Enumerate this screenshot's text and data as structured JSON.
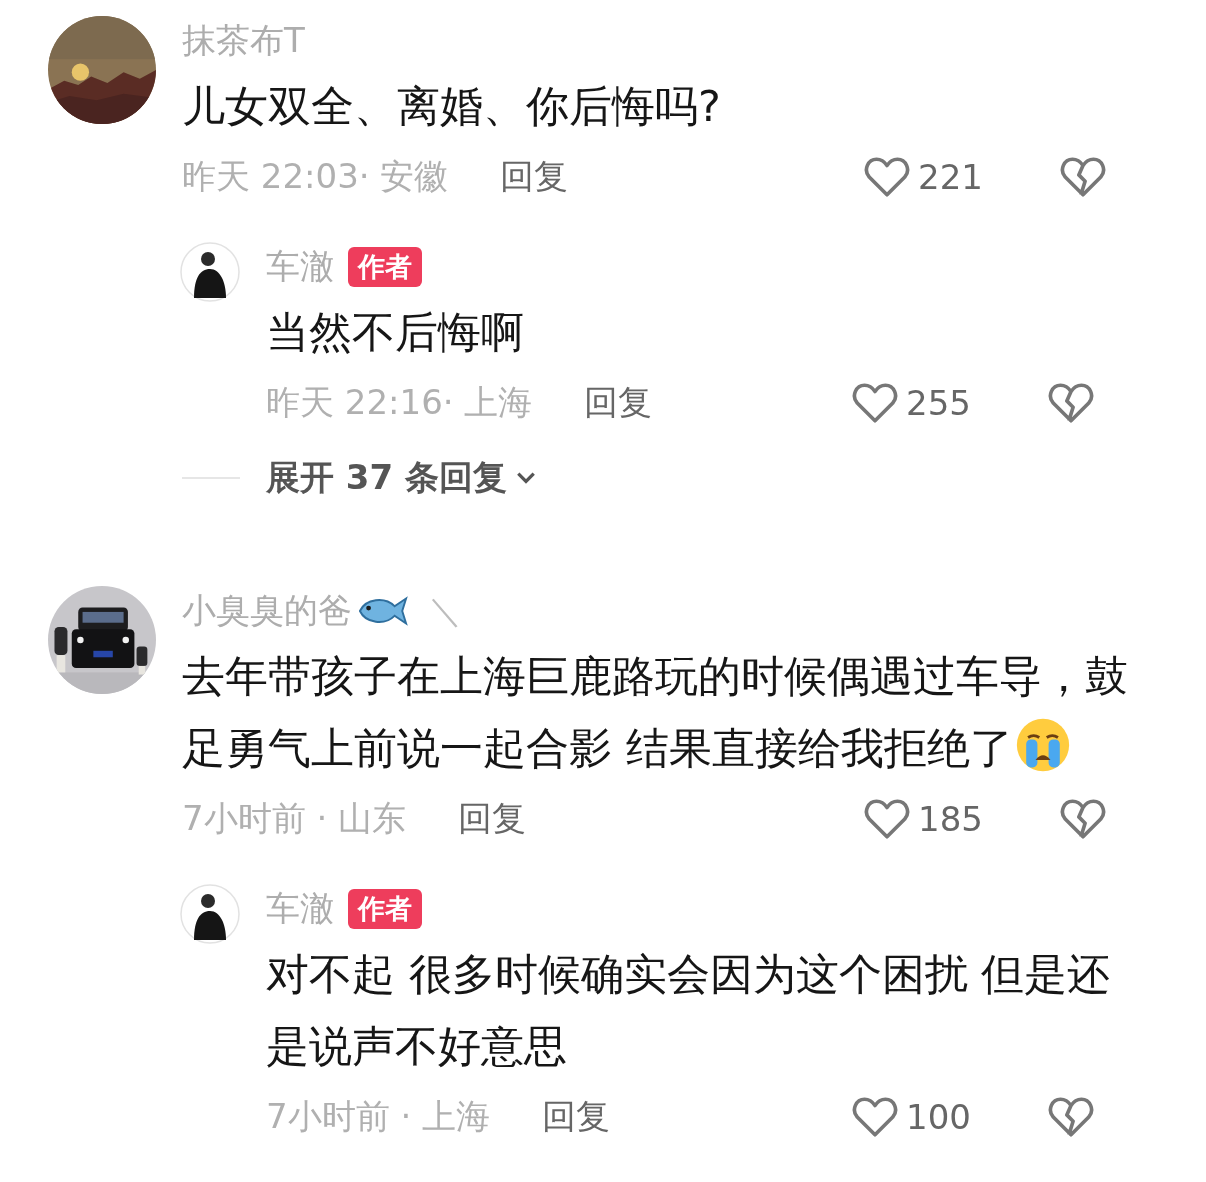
{
  "comments": [
    {
      "avatar": {
        "kind": "landscape"
      },
      "name": "抹茶布T",
      "fish_emoji": false,
      "text": "儿女双全、离婚、你后悔吗?",
      "crying_emoji": false,
      "time": "昨天 22:03· 安徽",
      "reply": "回复",
      "likes": "221",
      "replies": [
        {
          "avatar": {
            "kind": "person"
          },
          "name": "车澈",
          "badge": "作者",
          "text": "当然不后悔啊",
          "time": "昨天 22:16· 上海",
          "reply": "回复",
          "likes": "255"
        }
      ],
      "expand": "展开 37 条回复"
    },
    {
      "avatar": {
        "kind": "car"
      },
      "name": "小臭臭的爸",
      "fish_emoji": true,
      "name_suffix": "＼",
      "text": "去年带孩子在上海巨鹿路玩的时候偶遇过车导，鼓足勇气上前说一起合影 结果直接给我拒绝了",
      "crying_emoji": true,
      "time": "7小时前 · 山东",
      "reply": "回复",
      "likes": "185",
      "replies": [
        {
          "avatar": {
            "kind": "person"
          },
          "name": "车澈",
          "badge": "作者",
          "text": "对不起 很多时候确实会因为这个困扰 但是还是说声不好意思",
          "time": "7小时前 · 上海",
          "reply": "回复",
          "likes": "100"
        }
      ]
    }
  ]
}
